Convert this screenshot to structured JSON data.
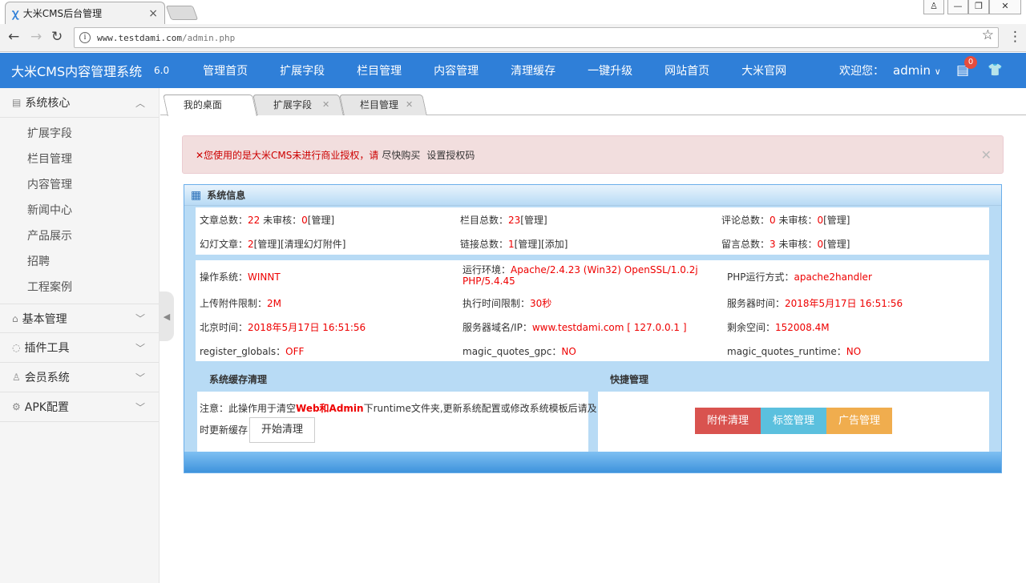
{
  "browser": {
    "tab_title": "大米CMS后台管理",
    "tab_close": "×",
    "url_host": "www.testdami.com",
    "url_path": "/admin.php",
    "window_buttons": [
      "♙",
      "—",
      "❐",
      "✕"
    ]
  },
  "topnav": {
    "brand": "大米CMS内容管理系统",
    "version": "6.0",
    "items": [
      "管理首页",
      "扩展字段",
      "栏目管理",
      "内容管理",
      "清理缓存",
      "一键升级",
      "网站首页",
      "大米官网"
    ],
    "welcome": "欢迎您：",
    "user": "admin",
    "badge": "0"
  },
  "sidebar": {
    "groups": [
      {
        "label": "系统核心",
        "icon": "book-icon",
        "expanded": true,
        "items": [
          "扩展字段",
          "栏目管理",
          "内容管理",
          "新闻中心",
          "产品展示",
          "招聘",
          "工程案例"
        ]
      },
      {
        "label": "基本管理",
        "icon": "home-icon",
        "expanded": false
      },
      {
        "label": "插件工具",
        "icon": "chat-icon",
        "expanded": false
      },
      {
        "label": "会员系统",
        "icon": "user-icon",
        "expanded": false
      },
      {
        "label": "APK配置",
        "icon": "gear-icon",
        "expanded": false
      }
    ]
  },
  "content_tabs": [
    {
      "label": "我的桌面",
      "closable": false
    },
    {
      "label": "扩展字段",
      "closable": true
    },
    {
      "label": "栏目管理",
      "closable": true
    }
  ],
  "alert": {
    "prefix": "✕您使用的是大米CMS未进行商业授权，请",
    "link1": "尽快购买",
    "link2": "设置授权码"
  },
  "sysinfo": {
    "title": "系统信息",
    "stats": {
      "article_label": "文章总数：",
      "article_total": "22",
      "article_pending_label": " 未审核：",
      "article_pending": "0",
      "article_manage": "[管理]",
      "column_label": "栏目总数：",
      "column_total": "23",
      "column_manage": "[管理]",
      "comment_label": "评论总数：",
      "comment_total": "0",
      "comment_pending_label": " 未审核：",
      "comment_pending": "0",
      "comment_manage": "[管理]",
      "slide_label": "幻灯文章：",
      "slide_total": "2",
      "slide_manage": "[管理]",
      "slide_clear": "[清理幻灯附件]",
      "link_label": "链接总数：",
      "link_total": "1",
      "link_manage": "[管理]",
      "link_add": "[添加]",
      "msg_label": "留言总数：",
      "msg_total": "3",
      "msg_pending_label": " 未审核：",
      "msg_pending": "0",
      "msg_manage": "[管理]"
    },
    "env": {
      "os_label": "操作系统：",
      "os": "WINNT",
      "runtime_label": "运行环境：",
      "runtime_line1": "Apache/2.4.23 (Win32) OpenSSL/1.0.2j",
      "runtime_line2": "PHP/5.4.45",
      "php_mode_label": "PHP运行方式：",
      "php_mode": "apache2handler",
      "upload_label": "上传附件限制：",
      "upload": "2M",
      "exec_label": "执行时间限制：",
      "exec": "30秒",
      "server_time_label": "服务器时间：",
      "server_time": "2018年5月17日 16:51:56",
      "beijing_label": "北京时间：",
      "beijing": "2018年5月17日 16:51:56",
      "domain_label": "服务器域名/IP：",
      "domain": "www.testdami.com [ 127.0.0.1 ]",
      "space_label": "剩余空间：",
      "space": "152008.4M",
      "rg_label": "register_globals：",
      "rg": "OFF",
      "mqg_label": "magic_quotes_gpc：",
      "mqg": "NO",
      "mqr_label": "magic_quotes_runtime：",
      "mqr": "NO"
    }
  },
  "cache": {
    "title": "系统缓存清理",
    "note_prefix": "注意：此操作用于清空",
    "note_bold": "Web和Admin",
    "note_suffix1": "下runtime文件夹,更新系统配置或修改系统模板后请及",
    "note_suffix2": "时更新缓存",
    "button": "开始清理"
  },
  "quick": {
    "title": "快捷管理",
    "buttons": [
      {
        "label": "附件清理",
        "color": "#d9534f"
      },
      {
        "label": "标签管理",
        "color": "#5bc0de"
      },
      {
        "label": "广告管理",
        "color": "#f0ad4e"
      }
    ]
  }
}
